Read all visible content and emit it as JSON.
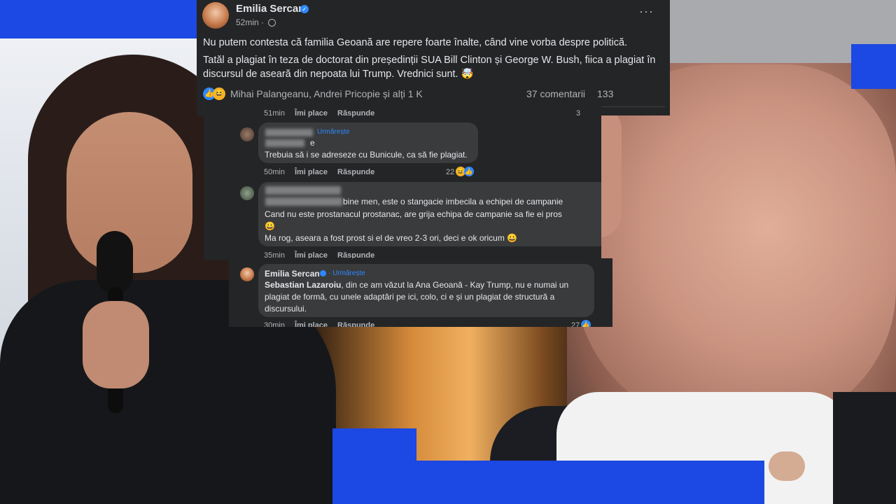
{
  "post": {
    "author": "Emilia Sercan",
    "time": "52min ·",
    "more_icon": "···",
    "line1": "Nu putem contesta că familia Geoană are repere foarte înalte, când vine vorba despre politică.",
    "line2a": "Tatăl a plagiat în teza de doctorat din președinții SUA Bill Clinton și George W. Bush, fiica a plagiat în",
    "line2b": "discursul de aseară din nepoata lui Trump. Vrednici sunt. 🤯",
    "reaction_names": "Mihai Palangeanu, Andrei Pricopie și alți 1 K",
    "comments_count": "37 comentarii",
    "shares_count": "133"
  },
  "comments": {
    "top_meta": {
      "time": "51min",
      "like": "Îmi place",
      "reply": "Răspunde",
      "count": "3"
    },
    "c1": {
      "follow": "Urmărește",
      "name_tail": "e",
      "text": "Trebuia să i se adreseze cu Bunicule, ca să fie plagiat.",
      "time": "50min",
      "like": "Îmi place",
      "reply": "Răspunde",
      "count": "22"
    },
    "c2": {
      "line1": "bine men, este o stangacie imbecila a echipei de campanie",
      "line2": "Cand nu este prostanacul prostanac, are grija echipa de campanie sa fie ei pros",
      "line3": "😀",
      "line4": "Ma rog, aseara a fost prost si el de vreo 2-3 ori, deci e ok oricum 😀",
      "time": "35min",
      "like": "Îmi place",
      "reply": "Răspunde"
    }
  },
  "reply": {
    "author": "Emilia Sercan",
    "follow": "· Urmărește",
    "mention": "Sebastian Lazaroiu",
    "line1_rest": ", din ce am văzut la Ana Geoană - Kay Trump, nu e numai un",
    "line2": "plagiat de formă, cu unele adaptări pe ici, colo, ci e și un plagiat de structură a",
    "line3": "discursului.",
    "time": "30min",
    "like": "Îmi place",
    "reply": "Răspunde",
    "count": "27"
  },
  "colors": {
    "accent_blue": "#1c48e3",
    "fb_dark": "#242526",
    "fb_bubble": "#3a3b3c",
    "fb_link": "#2d88ff"
  }
}
